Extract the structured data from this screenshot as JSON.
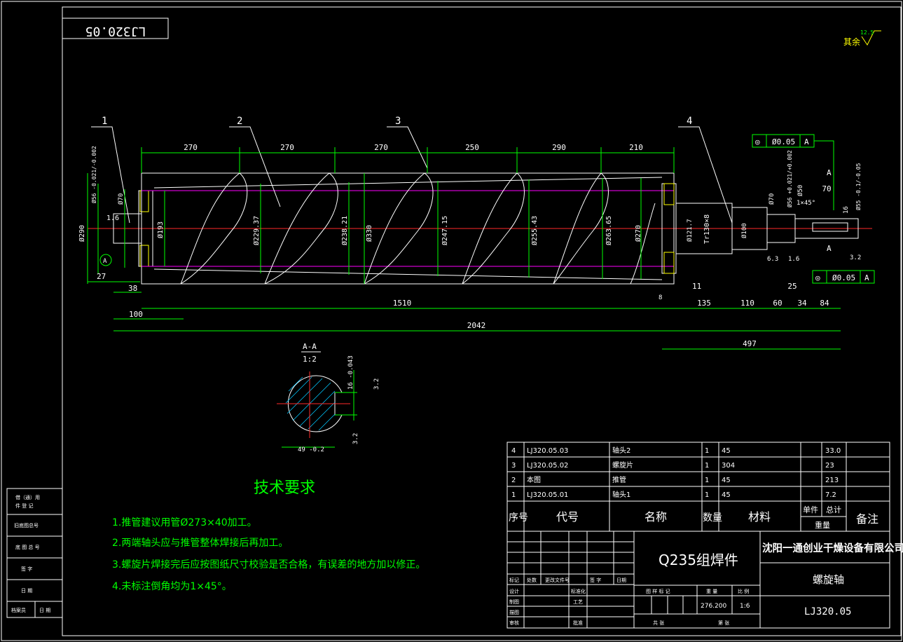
{
  "drawing_number_mirrored": "LJ320.05",
  "roughness_note": {
    "label": "其余",
    "value": "12.5"
  },
  "balloons": [
    "1",
    "2",
    "3",
    "4"
  ],
  "dims_top": [
    "270",
    "270",
    "270",
    "250",
    "290",
    "210"
  ],
  "dims_left": [
    "Ø56 -0.021/-0.002",
    "Ø70",
    "Ø290",
    "1.6",
    "A",
    "27",
    "38",
    "100"
  ],
  "dims_body": [
    "Ø193",
    "Ø229.37",
    "Ø238.21",
    "Ø330",
    "Ø247.15",
    "Ø255.43",
    "Ø263.65",
    "Ø270"
  ],
  "dims_bottom": {
    "d1510": "1510",
    "d2042": "2042",
    "d497": "497",
    "d8": "8",
    "d11": "11",
    "d135": "135",
    "d110": "110",
    "d60": "60",
    "d25": "25",
    "d34": "34",
    "d84": "84",
    "d70": "70",
    "d6_3": "6.3",
    "d1_6": "1.6",
    "d3_2": "3.2",
    "d16": "16"
  },
  "dims_right": {
    "thread": "Tr130×8",
    "d121": "Ø121.7",
    "d100": "Ø100",
    "d70": "Ø70",
    "d56": "Ø56 +0.021/+0.002",
    "d50": "Ø50",
    "chamfer": "1×45°",
    "d55": "Ø55 -0.1/-0.05"
  },
  "tolerance_frames": [
    {
      "symbol": "◎",
      "value": "Ø0.05",
      "datum": "A"
    },
    {
      "symbol": "◎",
      "value": "Ø0.05",
      "datum": "A"
    }
  ],
  "section": {
    "label": "A-A",
    "scale": "1:2",
    "dim_width": "16 -0.043",
    "dim_depth": "49 -0.2",
    "rough1": "3.2",
    "rough2": "3.2",
    "cut_label": "A"
  },
  "notes": {
    "title": "技术要求",
    "items": [
      "1.推管建议用管Ø273×40加工。",
      "2.两端轴头应与推管整体焊接后再加工。",
      "3.螺旋片焊接完后应按图纸尺寸校验是否合格，有误差的地方加以修正。",
      "4.未标注倒角均为1×45°。"
    ]
  },
  "bom": {
    "rows": [
      {
        "no": "4",
        "code": "LJ320.05.03",
        "name": "轴头2",
        "qty": "1",
        "material": "45",
        "unit": "",
        "total": "33.0",
        "remark": ""
      },
      {
        "no": "3",
        "code": "LJ320.05.02",
        "name": "螺旋片",
        "qty": "1",
        "material": "304",
        "unit": "",
        "total": "23",
        "remark": ""
      },
      {
        "no": "2",
        "code": "本图",
        "name": "推管",
        "qty": "1",
        "material": "45",
        "unit": "",
        "total": "213",
        "remark": ""
      },
      {
        "no": "1",
        "code": "LJ320.05.01",
        "name": "轴头1",
        "qty": "1",
        "material": "45",
        "unit": "",
        "total": "7.2",
        "remark": ""
      }
    ],
    "header": {
      "no": "序号",
      "code": "代号",
      "name": "名称",
      "qty": "数量",
      "material": "材料",
      "unit": "单件",
      "total": "总计",
      "weight": "重量",
      "remark": "备注"
    }
  },
  "title_block": {
    "material": "Q235组焊件",
    "company": "沈阳一通创业干燥设备有限公司",
    "part_name": "螺旋轴",
    "drawing_no": "LJ320.05",
    "weight": "276.200",
    "scale": "1:6",
    "labels": {
      "mark": "标记",
      "count": "处数",
      "doc": "更改文件号",
      "sign": "签 字",
      "date": "日期",
      "design": "设计",
      "draw": "制图",
      "check": "描图",
      "review": "审核",
      "std": "标准化",
      "craft": "工艺",
      "approve": "批准",
      "stage": "图 样 标 记",
      "weight_l": "重 量",
      "scale_l": "比 例",
      "sheet": "共    张",
      "page": "第    张"
    }
  },
  "side_block": [
    "借（通）用",
    "件 登 记",
    "旧底图总号",
    "底 图 总 号",
    "签    字",
    "日    期",
    "档案员",
    "日 期"
  ]
}
